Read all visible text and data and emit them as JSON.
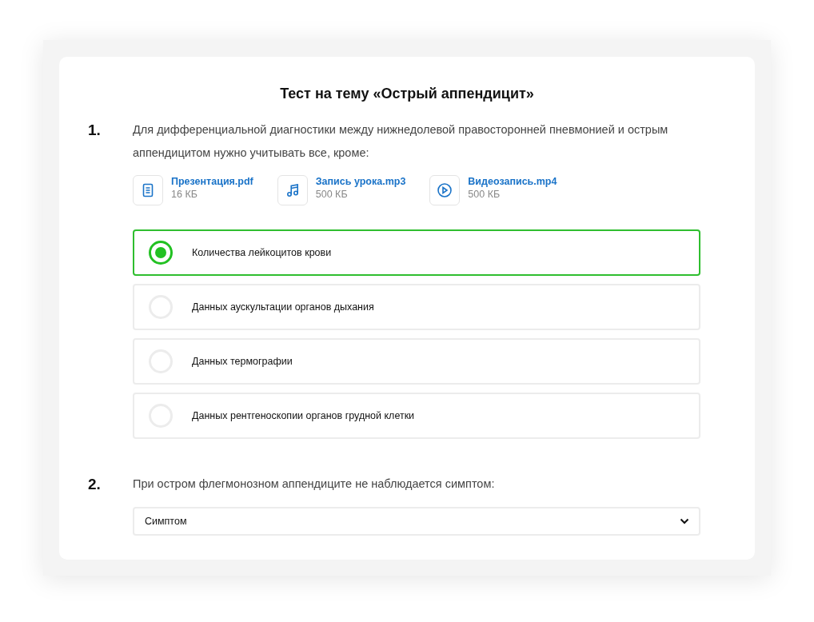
{
  "title": "Тест на тему «Острый аппендицит»",
  "questions": [
    {
      "number": "1.",
      "kind": "radio",
      "text": "Для дифференциальной диагностики между нижнедолевой правосторонней пневмонией и острым аппендицитом нужно учитывать все, кроме:",
      "attachments": [
        {
          "kind": "document",
          "name": "Презентация.pdf",
          "size": "16 КБ"
        },
        {
          "kind": "audio",
          "name": "Запись урока.mp3",
          "size": "500 КБ"
        },
        {
          "kind": "video",
          "name": "Видеозапись.mp4",
          "size": "500 КБ"
        }
      ],
      "options": [
        {
          "label": "Количества лейкоцитов крови",
          "selected": true
        },
        {
          "label": "Данных аускультации органов дыхания",
          "selected": false
        },
        {
          "label": "Данных термографии",
          "selected": false
        },
        {
          "label": "Данных рентгеноскопии органов грудной клетки",
          "selected": false
        }
      ]
    },
    {
      "number": "2.",
      "kind": "select",
      "text": "При остром флегмонозном аппендиците не наблюдается симптом:",
      "value": "Симптом"
    }
  ]
}
